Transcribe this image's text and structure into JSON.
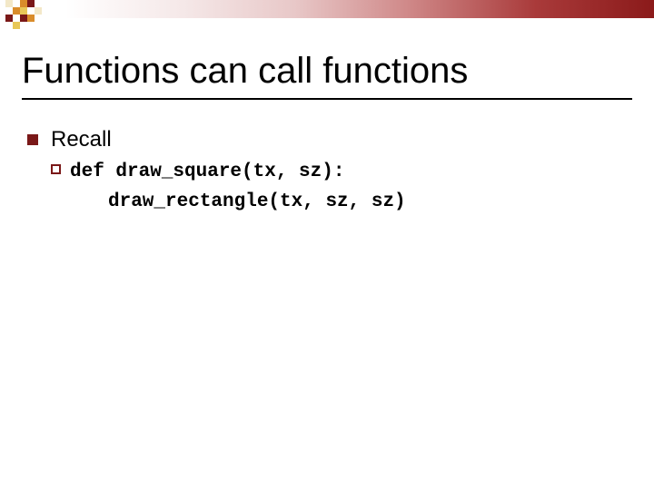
{
  "colors": {
    "accent_dark": "#7a1818",
    "pixel_orange": "#d98c2b",
    "pixel_yellow": "#e8c758",
    "pixel_cream": "#f3e8c8"
  },
  "slide": {
    "title": "Functions can call functions",
    "bullet": {
      "label": "Recall",
      "code_line1": "def draw_square(tx, sz):",
      "code_line2": "draw_rectangle(tx, sz, sz)"
    }
  }
}
